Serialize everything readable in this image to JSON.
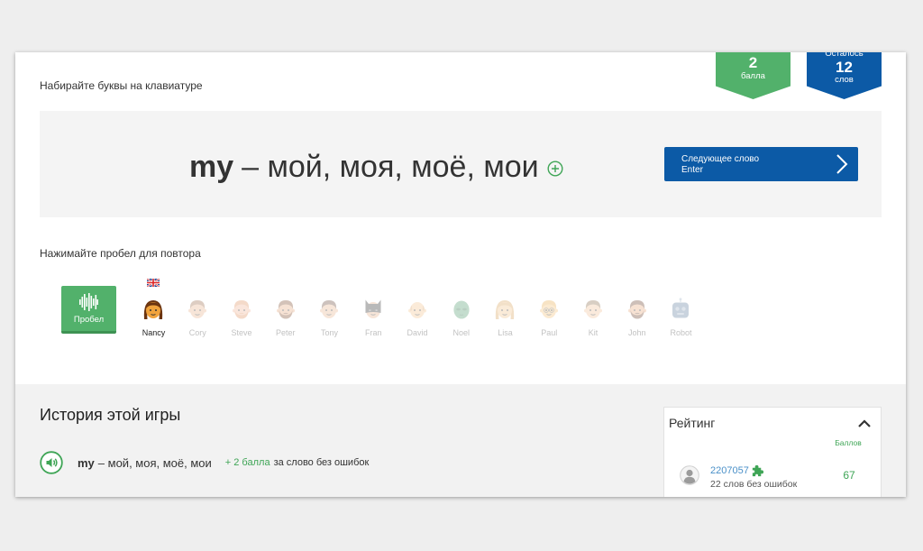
{
  "instruction": "Набирайте буквы на клавиатуре",
  "badges": {
    "score": {
      "value": "2",
      "label": "балла",
      "color": "#52b16b"
    },
    "remaining": {
      "caption": "Осталось",
      "value": "12",
      "label": "слов",
      "color": "#0c5aa6"
    }
  },
  "word_card": {
    "word": "my",
    "translation": "– мой, моя, моё, мои",
    "add_icon": "plus-circle-icon",
    "next_button": {
      "label": "Следующее слово",
      "shortcut": "Enter",
      "icon": "chevron-right-icon"
    }
  },
  "repeat_hint": "Нажимайте пробел для повтора",
  "space_button": {
    "label": "Пробел",
    "icon": "sound-wave-icon"
  },
  "voices": [
    {
      "name": "Nancy",
      "icon": "woman-face-icon",
      "flag": "uk-flag-icon",
      "active": true,
      "skin": "#f1a33c",
      "hair": "#6b3410"
    },
    {
      "name": "Cory",
      "icon": "man-face-icon",
      "active": false,
      "skin": "#e8b18c",
      "hair": "#9a6a48"
    },
    {
      "name": "Steve",
      "icon": "bearded-man-face-icon",
      "active": false,
      "skin": "#f0b596",
      "hair": "#e0905e"
    },
    {
      "name": "Peter",
      "icon": "bearded-man-face-icon",
      "active": false,
      "skin": "#e6a97e",
      "hair": "#7b4a2a"
    },
    {
      "name": "Tony",
      "icon": "man-face-icon",
      "active": false,
      "skin": "#e9b48f",
      "hair": "#6a4a3a"
    },
    {
      "name": "Fran",
      "icon": "bat-mask-face-icon",
      "active": false,
      "skin": "#e7b28c",
      "hair": "#2f2f2f"
    },
    {
      "name": "David",
      "icon": "bald-man-face-icon",
      "active": false,
      "skin": "#f3c48e",
      "hair": "#d8a46a"
    },
    {
      "name": "Noel",
      "icon": "alien-face-icon",
      "active": false,
      "skin": "#4f9b6c",
      "hair": "#2f6e48"
    },
    {
      "name": "Lisa",
      "icon": "woman-face-icon",
      "active": false,
      "skin": "#f2c38c",
      "hair": "#d9a35b"
    },
    {
      "name": "Paul",
      "icon": "glasses-man-face-icon",
      "active": false,
      "skin": "#f3c277",
      "hair": "#e7ad4e"
    },
    {
      "name": "Kit",
      "icon": "man-face-icon",
      "active": false,
      "skin": "#f0c196",
      "hair": "#8c6c4c"
    },
    {
      "name": "John",
      "icon": "bearded-man-face-icon",
      "active": false,
      "skin": "#e8a97c",
      "hair": "#6b3f2c"
    },
    {
      "name": "Robot",
      "icon": "robot-face-icon",
      "active": false,
      "skin": "#5d7d9c",
      "hair": "#9fb2c6"
    }
  ],
  "history": {
    "title": "История этой игры",
    "items": [
      {
        "icon": "speaker-icon",
        "word": "my",
        "translation": "– мой, моя, моё, мои",
        "points": "+ 2 балла",
        "note": "за слово без ошибок"
      }
    ]
  },
  "rating": {
    "title": "Рейтинг",
    "toggle_icon": "chevron-up-icon",
    "column_label": "Баллов",
    "rows": [
      {
        "avatar_icon": "user-avatar-icon",
        "user": "2207057",
        "badge_icon": "puzzle-icon",
        "subtitle": "22 слов без ошибок",
        "score": "67"
      }
    ]
  },
  "colors": {
    "green": "#3fa556",
    "blue": "#0c5aa6",
    "link": "#4a90c8",
    "panel": "#f4f4f4"
  }
}
